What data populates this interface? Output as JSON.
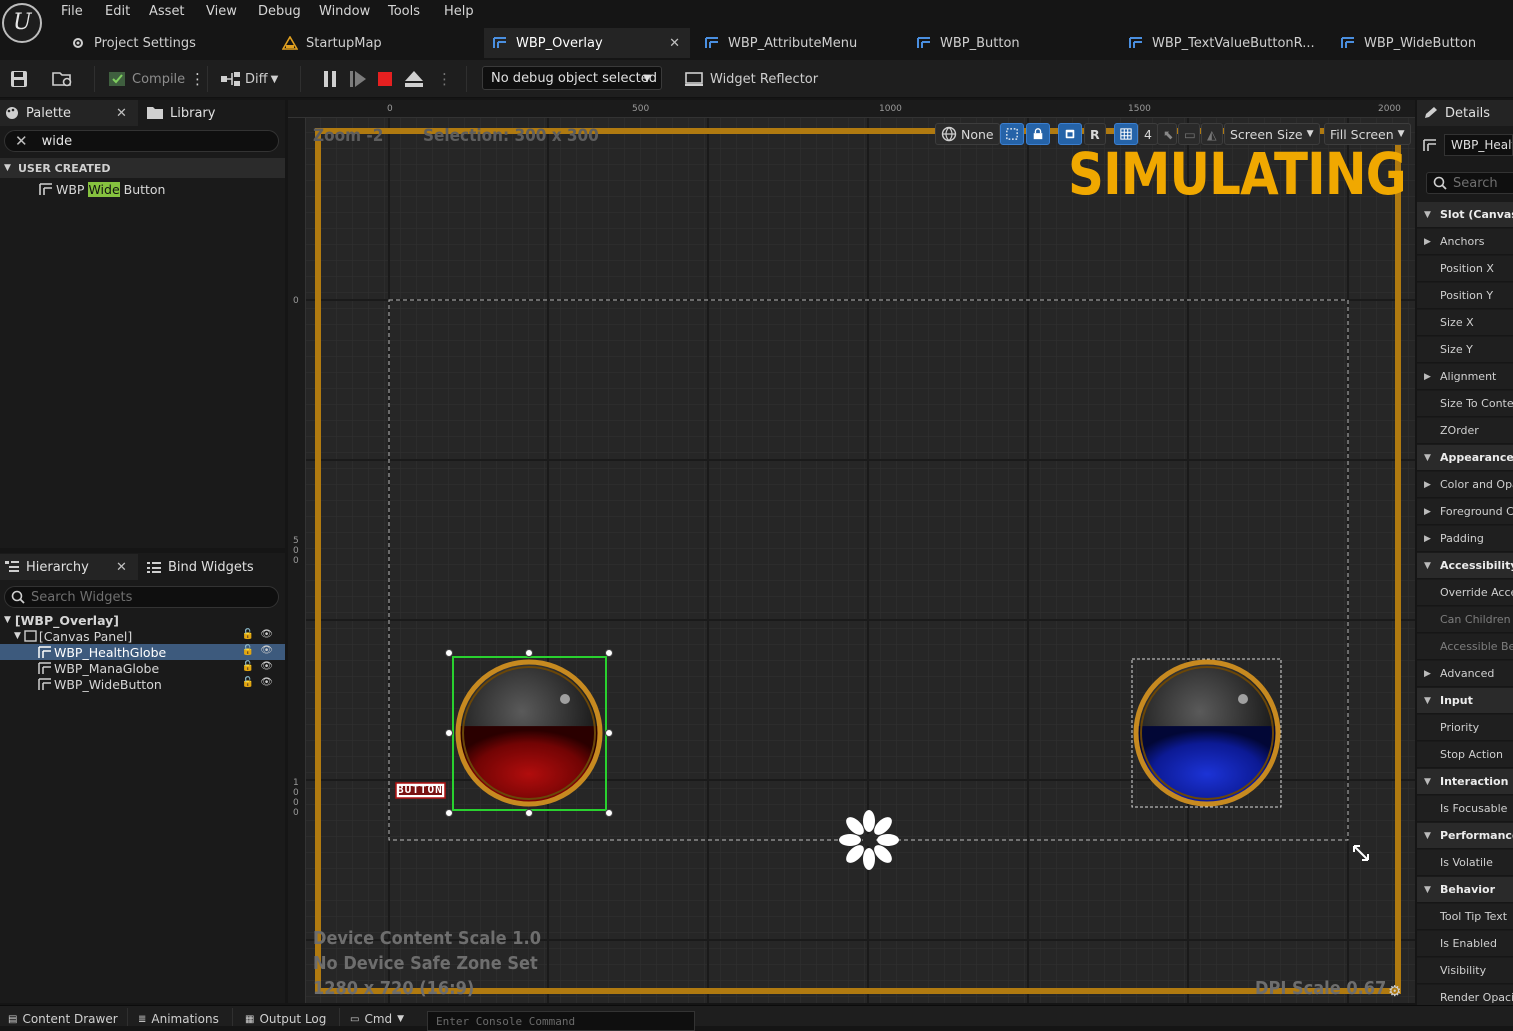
{
  "menu": {
    "items": [
      "File",
      "Edit",
      "Asset",
      "View",
      "Debug",
      "Window",
      "Tools",
      "Help"
    ]
  },
  "tabs": [
    {
      "label": "Project Settings",
      "icon": "settings-icon"
    },
    {
      "label": "StartupMap",
      "icon": "map-icon"
    },
    {
      "label": "WBP_Overlay",
      "icon": "widget-blueprint-icon",
      "active": true
    },
    {
      "label": "WBP_AttributeMenu",
      "icon": "widget-blueprint-icon"
    },
    {
      "label": "WBP_Button",
      "icon": "widget-blueprint-icon"
    },
    {
      "label": "WBP_TextValueButtonR...",
      "icon": "widget-blueprint-icon"
    },
    {
      "label": "WBP_WideButton",
      "icon": "widget-blueprint-icon"
    }
  ],
  "toolbar": {
    "compile_label": "Compile",
    "diff_label": "Diff",
    "debug_object": "No debug object selected",
    "widget_reflector_label": "Widget Reflector"
  },
  "palette": {
    "tab_label": "Palette",
    "library_label": "Library",
    "search_value": "wide",
    "category": "USER CREATED",
    "result_prefix": "WBP ",
    "result_match": "Wide",
    "result_suffix": " Button"
  },
  "hierarchy": {
    "tab_label": "Hierarchy",
    "bind_label": "Bind Widgets",
    "search_placeholder": "Search Widgets",
    "root": "[WBP_Overlay]",
    "canvas": "[Canvas Panel]",
    "children": [
      "WBP_HealthGlobe",
      "WBP_ManaGlobe",
      "WBP_WideButton"
    ],
    "selected": "WBP_HealthGlobe"
  },
  "viewport": {
    "zoom_text": "Zoom -2",
    "selection_text": "Selection: 300 x 300",
    "simulating_text": "SIMULATING",
    "top_ruler_labels": [
      "0",
      "500",
      "1000",
      "1500",
      "2000"
    ],
    "left_ruler_labels": [
      "0",
      "5\n0\n0",
      "1\n0\n0\n0"
    ],
    "none_label": "None",
    "r_label": "R",
    "grid_value": "4",
    "screen_size_label": "Screen Size",
    "fill_screen_label": "Fill Screen",
    "device_scale_text": "Device Content Scale 1.0",
    "safe_zone_text": "No Device Safe Zone Set",
    "resolution_text": "1280 x 720 (16:9)",
    "dpi_text": "DPI Scale 0.67",
    "button_label": "BUTTON",
    "health_fill": 0.55,
    "mana_fill": 0.55,
    "colors": {
      "frame": "#b07a10",
      "simulating": "#f0a800",
      "health": "#8b0000",
      "mana": "#0d1e9c",
      "selection": "#29d12f"
    }
  },
  "details": {
    "tab_label": "Details",
    "name_value": "WBP_HealthGlobe",
    "search_placeholder": "Search",
    "rows": [
      {
        "label": "Slot (Canvas Panel Slot)",
        "type": "cat"
      },
      {
        "label": "Anchors",
        "type": "expand"
      },
      {
        "label": "Position X",
        "type": "prop"
      },
      {
        "label": "Position Y",
        "type": "prop"
      },
      {
        "label": "Size X",
        "type": "prop"
      },
      {
        "label": "Size Y",
        "type": "prop"
      },
      {
        "label": "Alignment",
        "type": "expand"
      },
      {
        "label": "Size To Content",
        "type": "prop"
      },
      {
        "label": "ZOrder",
        "type": "prop"
      },
      {
        "label": "Appearance",
        "type": "cat"
      },
      {
        "label": "Color and Opacity",
        "type": "expand"
      },
      {
        "label": "Foreground Color",
        "type": "expand"
      },
      {
        "label": "Padding",
        "type": "expand"
      },
      {
        "label": "Accessibility",
        "type": "cat"
      },
      {
        "label": "Override Accessible Defaults",
        "type": "prop"
      },
      {
        "label": "Can Children be Accessible",
        "type": "dim"
      },
      {
        "label": "Accessible Behavior",
        "type": "dim"
      },
      {
        "label": "Advanced",
        "type": "expand"
      },
      {
        "label": "Input",
        "type": "cat"
      },
      {
        "label": "Priority",
        "type": "prop"
      },
      {
        "label": "Stop Action",
        "type": "prop"
      },
      {
        "label": "Interaction",
        "type": "cat"
      },
      {
        "label": "Is Focusable",
        "type": "prop"
      },
      {
        "label": "Performance",
        "type": "cat"
      },
      {
        "label": "Is Volatile",
        "type": "prop"
      },
      {
        "label": "Behavior",
        "type": "cat"
      },
      {
        "label": "Tool Tip Text",
        "type": "prop"
      },
      {
        "label": "Is Enabled",
        "type": "prop"
      },
      {
        "label": "Visibility",
        "type": "prop"
      },
      {
        "label": "Render Opacity",
        "type": "prop"
      }
    ]
  },
  "statusbar": {
    "content_drawer": "Content Drawer",
    "animations": "Animations",
    "output_log": "Output Log",
    "cmd": "Cmd",
    "console_placeholder": "Enter Console Command"
  }
}
